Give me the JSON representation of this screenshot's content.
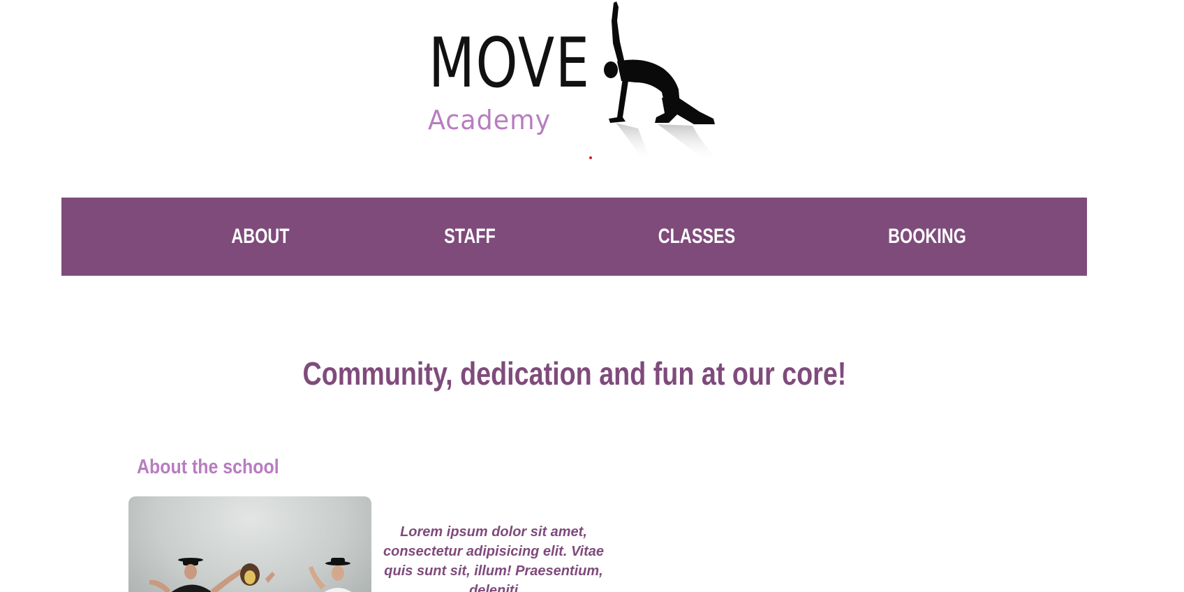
{
  "logo": {
    "title": "MOVE",
    "subtitle": "Academy",
    "icon": "dancer-silhouette-icon"
  },
  "nav": {
    "items": [
      {
        "label": "ABOUT"
      },
      {
        "label": "STAFF"
      },
      {
        "label": "CLASSES"
      },
      {
        "label": "BOOKING"
      }
    ]
  },
  "main": {
    "headline": "Community, dedication and fun at our core!",
    "about": {
      "title": "About the school",
      "text": "Lorem ipsum dolor sit amet, consectetur adipisicing elit. Vitae quis sunt sit, illum! Praesentium, deleniti"
    }
  },
  "colors": {
    "brand_purple": "#7f4b7b",
    "accent_lilac": "#b87cc0",
    "background": "#ffffff"
  }
}
